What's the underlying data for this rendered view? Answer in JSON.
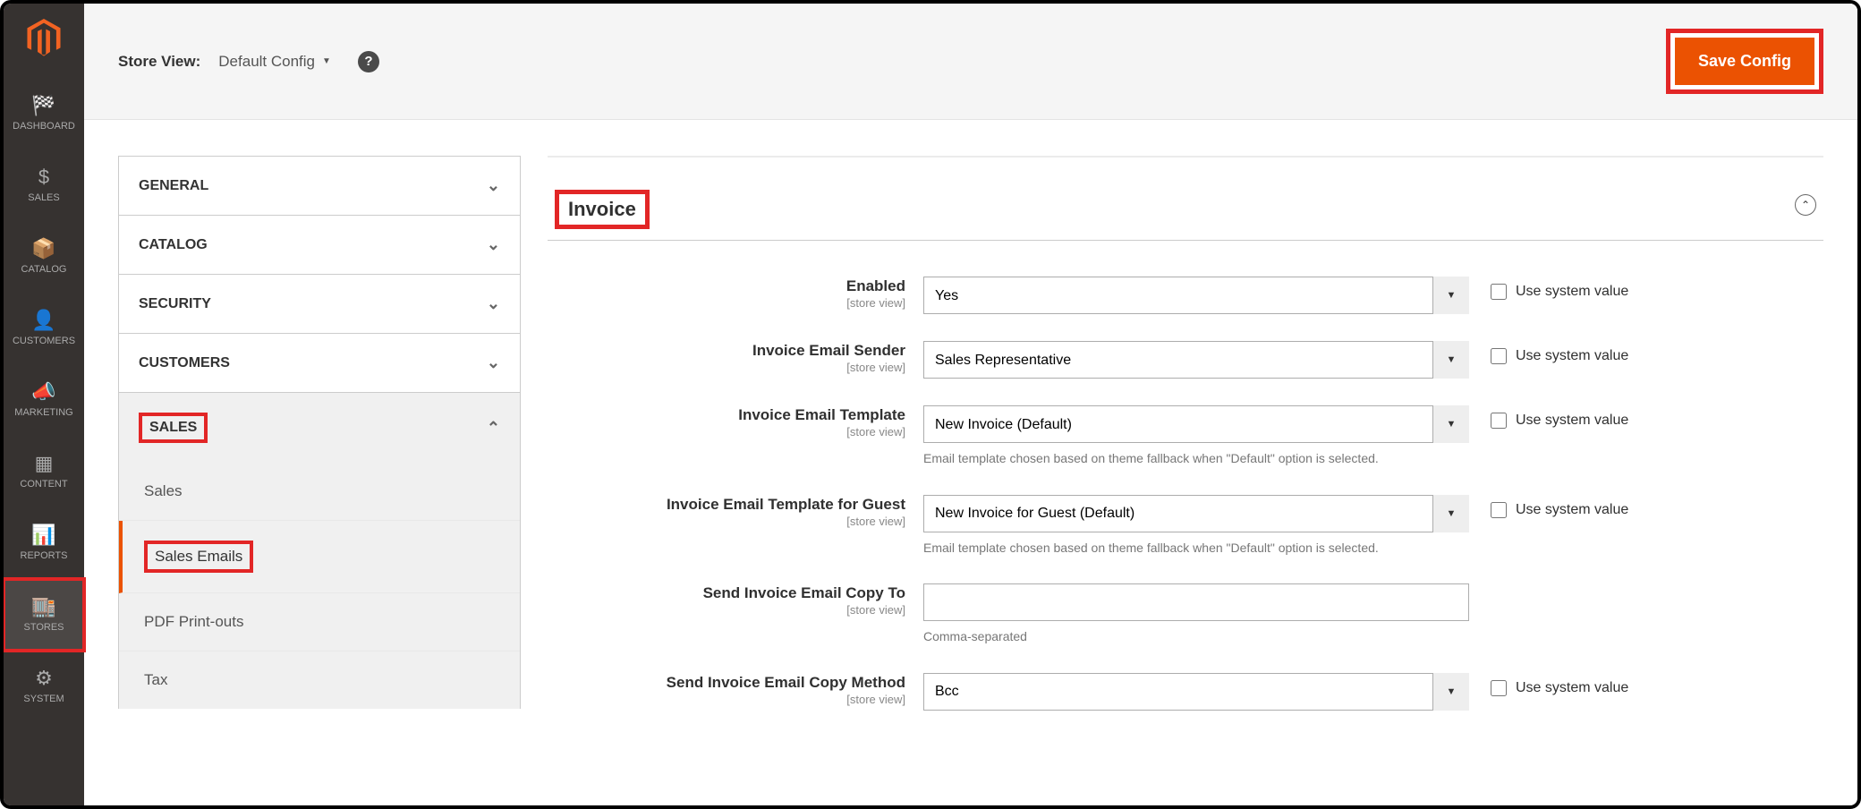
{
  "nav": {
    "items": [
      {
        "label": "DASHBOARD"
      },
      {
        "label": "SALES"
      },
      {
        "label": "CATALOG"
      },
      {
        "label": "CUSTOMERS"
      },
      {
        "label": "MARKETING"
      },
      {
        "label": "CONTENT"
      },
      {
        "label": "REPORTS"
      },
      {
        "label": "STORES"
      },
      {
        "label": "SYSTEM"
      }
    ]
  },
  "header": {
    "store_view_label": "Store View:",
    "store_view_value": "Default Config",
    "save_button": "Save Config"
  },
  "tabs": {
    "general": "GENERAL",
    "catalog": "CATALOG",
    "security": "SECURITY",
    "customers": "CUSTOMERS",
    "sales": "SALES",
    "sales_sub": {
      "sales": "Sales",
      "sales_emails": "Sales Emails",
      "pdf": "PDF Print-outs",
      "tax": "Tax"
    }
  },
  "section": {
    "title": "Invoice",
    "scope_label": "[store view]",
    "system_value_label": "Use system value",
    "fields": {
      "enabled": {
        "label": "Enabled",
        "value": "Yes"
      },
      "sender": {
        "label": "Invoice Email Sender",
        "value": "Sales Representative"
      },
      "template": {
        "label": "Invoice Email Template",
        "value": "New Invoice (Default)",
        "note": "Email template chosen based on theme fallback when \"Default\" option is selected."
      },
      "template_guest": {
        "label": "Invoice Email Template for Guest",
        "value": "New Invoice for Guest (Default)",
        "note": "Email template chosen based on theme fallback when \"Default\" option is selected."
      },
      "copy_to": {
        "label": "Send Invoice Email Copy To",
        "value": "",
        "note": "Comma-separated"
      },
      "copy_method": {
        "label": "Send Invoice Email Copy Method",
        "value": "Bcc"
      }
    }
  }
}
